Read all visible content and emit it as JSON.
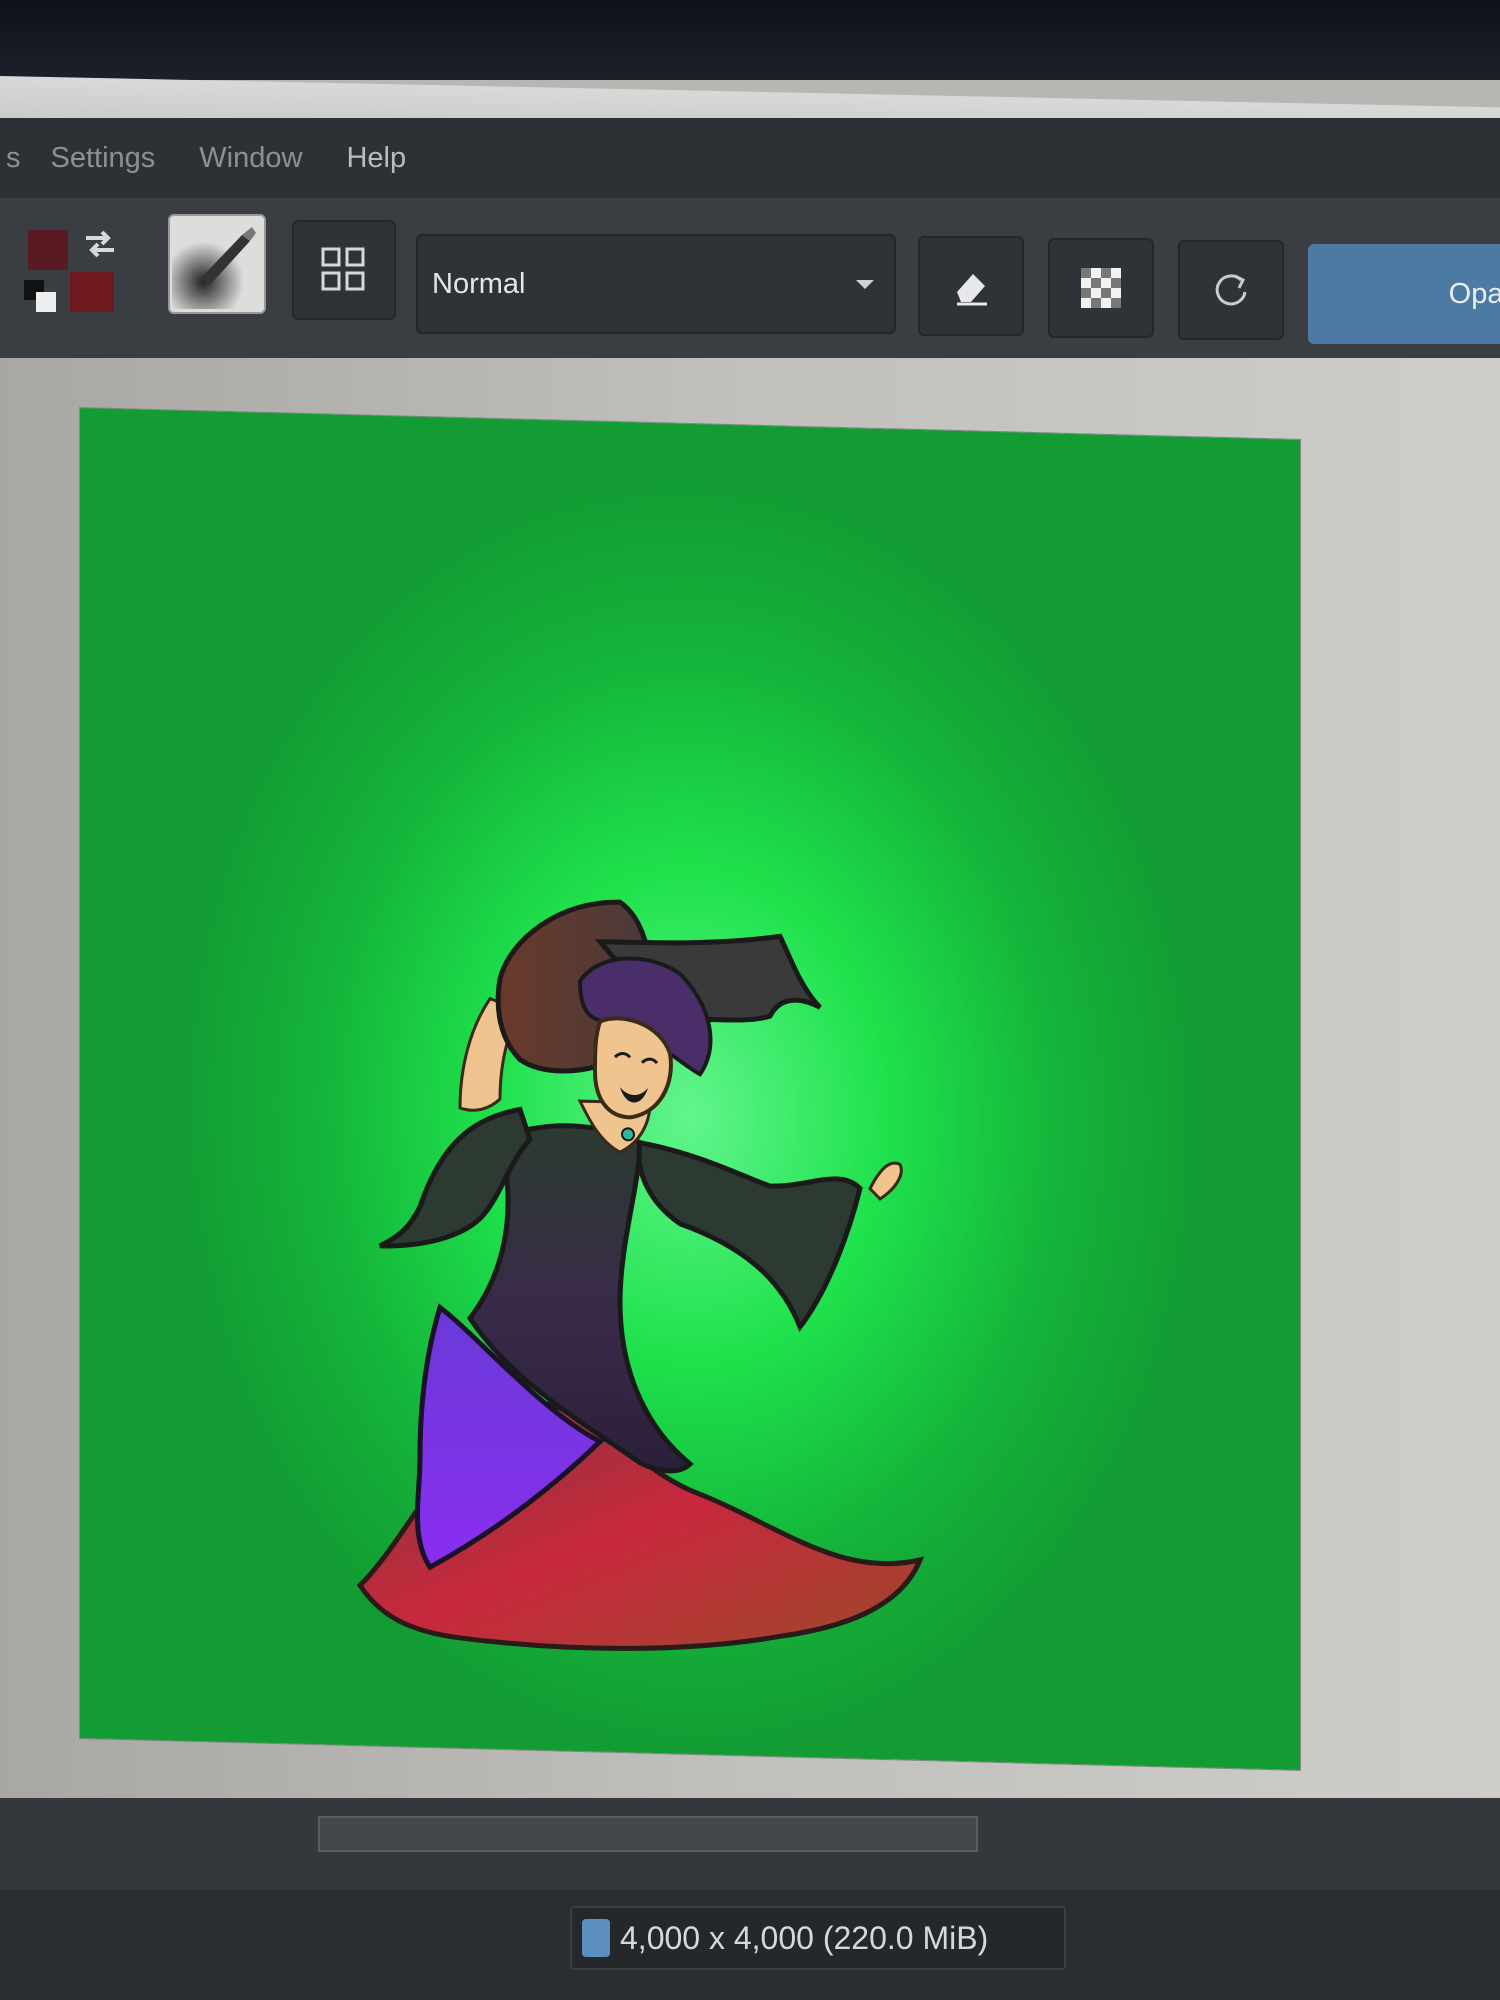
{
  "menu": {
    "items": [
      {
        "label": "s"
      },
      {
        "label": "Settings"
      },
      {
        "label": "Window"
      },
      {
        "label": "Help"
      }
    ]
  },
  "toolbar": {
    "blend_mode": "Normal",
    "opacity_label": "Opac"
  },
  "status": {
    "image_size": "4,000 x 4,000 (220.0 MiB)"
  },
  "colors": {
    "foreground": "#7a1f2a",
    "background": "#8b1c26",
    "accent": "#4c7aa2"
  },
  "icons": {
    "swap": "swap-colors-icon",
    "reset": "reset-colors-icon",
    "brush": "brush-preset-icon",
    "patterns": "pattern-grid-icon",
    "eraser": "eraser-icon",
    "alpha": "preserve-alpha-icon",
    "reload": "reload-preset-icon"
  }
}
